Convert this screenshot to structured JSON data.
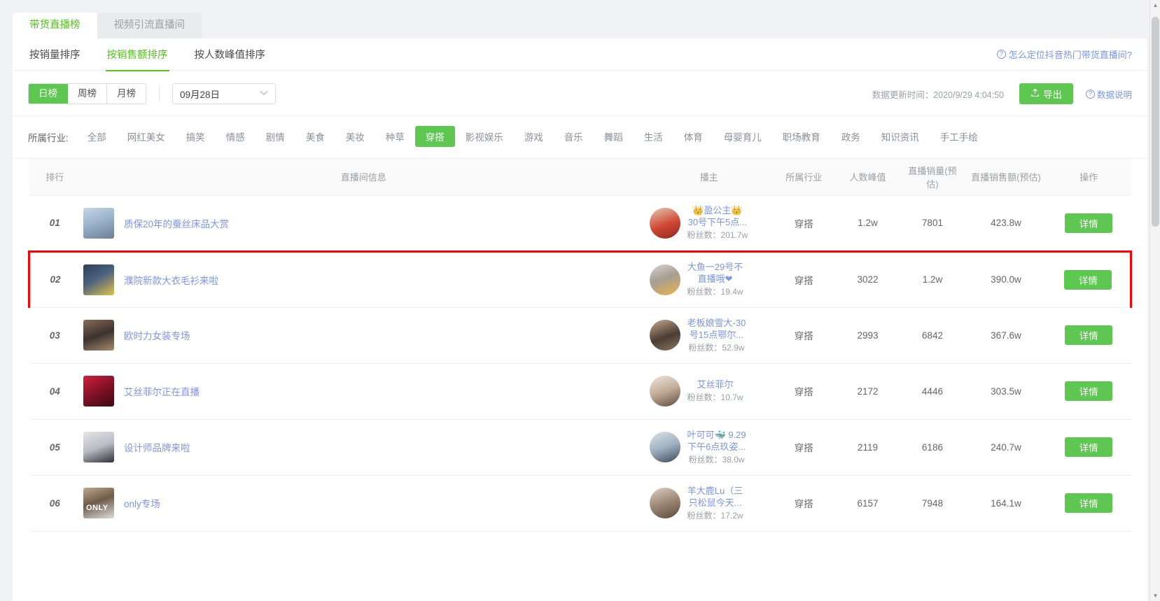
{
  "tabs": [
    {
      "label": "带货直播榜",
      "active": true
    },
    {
      "label": "视频引流直播间",
      "active": false
    }
  ],
  "sort_tabs": [
    {
      "label": "按销量排序",
      "active": false
    },
    {
      "label": "按销售额排序",
      "active": true
    },
    {
      "label": "按人数峰值排序",
      "active": false
    }
  ],
  "help_link": "怎么定位抖音热门带货直播间?",
  "period": [
    {
      "label": "日榜",
      "active": true
    },
    {
      "label": "周榜",
      "active": false
    },
    {
      "label": "月榜",
      "active": false
    }
  ],
  "date_select": {
    "value": "09月28日",
    "chevron": "chevron-down-icon"
  },
  "updated_text": "数据更新时间：2020/9/29 4:04:50",
  "export_button": "导出",
  "data_desc_link": "数据说明",
  "industry": {
    "label": "所属行业:",
    "items": [
      {
        "label": "全部",
        "active": false
      },
      {
        "label": "网红美女",
        "active": false
      },
      {
        "label": "搞笑",
        "active": false
      },
      {
        "label": "情感",
        "active": false
      },
      {
        "label": "剧情",
        "active": false
      },
      {
        "label": "美食",
        "active": false
      },
      {
        "label": "美妆",
        "active": false
      },
      {
        "label": "种草",
        "active": false
      },
      {
        "label": "穿搭",
        "active": true
      },
      {
        "label": "影视娱乐",
        "active": false
      },
      {
        "label": "游戏",
        "active": false
      },
      {
        "label": "音乐",
        "active": false
      },
      {
        "label": "舞蹈",
        "active": false
      },
      {
        "label": "生活",
        "active": false
      },
      {
        "label": "体育",
        "active": false
      },
      {
        "label": "母婴育儿",
        "active": false
      },
      {
        "label": "职场教育",
        "active": false
      },
      {
        "label": "政务",
        "active": false
      },
      {
        "label": "知识资讯",
        "active": false
      },
      {
        "label": "手工手绘",
        "active": false
      }
    ]
  },
  "table": {
    "columns": [
      "排行",
      "直播间信息",
      "播主",
      "所属行业",
      "人数峰值",
      "直播销量(预估)",
      "直播销售额(预估)",
      "操作"
    ],
    "action_label": "详情",
    "rows": [
      {
        "rank": "01",
        "room_title": "质保20年的蚕丝床品大赏",
        "host_name": "👑盈公主👑",
        "host_name2": "30号下午5点...",
        "fans": "粉丝数：201.7w",
        "industry": "穿搭",
        "peak": "1.2w",
        "sales": "7801",
        "amount": "423.8w",
        "action": "详情",
        "highlighted": false
      },
      {
        "rank": "02",
        "room_title": "濮院新款大衣毛衫来啦",
        "host_name": "大鱼一29号不",
        "host_name2": "直播哦❤",
        "fans": "粉丝数：19.4w",
        "industry": "穿搭",
        "peak": "3022",
        "sales": "1.2w",
        "amount": "390.0w",
        "action": "详情",
        "highlighted": true
      },
      {
        "rank": "03",
        "room_title": "欧时力女装专场",
        "host_name": "老板娘雪大-30",
        "host_name2": "号15点鄂尔...",
        "fans": "粉丝数：52.9w",
        "industry": "穿搭",
        "peak": "2993",
        "sales": "6842",
        "amount": "367.6w",
        "action": "详情",
        "highlighted": false
      },
      {
        "rank": "04",
        "room_title": "艾丝菲尔正在直播",
        "host_name": "艾丝菲尔",
        "host_name2": "",
        "fans": "粉丝数：10.7w",
        "industry": "穿搭",
        "peak": "2172",
        "sales": "4446",
        "amount": "303.5w",
        "action": "详情",
        "highlighted": false
      },
      {
        "rank": "05",
        "room_title": "设计师品牌来啦",
        "host_name": "叶可可🐳 9.29",
        "host_name2": "下午6点玖姿...",
        "fans": "粉丝数：38.0w",
        "industry": "穿搭",
        "peak": "2119",
        "sales": "6186",
        "amount": "240.7w",
        "action": "详情",
        "highlighted": false
      },
      {
        "rank": "06",
        "room_title": "only专场",
        "host_name": "羊大鹿Lu（三",
        "host_name2": "只松鼠今天...",
        "fans": "粉丝数：17.2w",
        "industry": "穿搭",
        "peak": "6157",
        "sales": "7948",
        "amount": "164.1w",
        "action": "详情",
        "highlighted": false
      }
    ]
  },
  "colors": {
    "accent_green": "#5ec752",
    "link_blue": "#7a96e8",
    "highlight_red": "#ff0000"
  }
}
